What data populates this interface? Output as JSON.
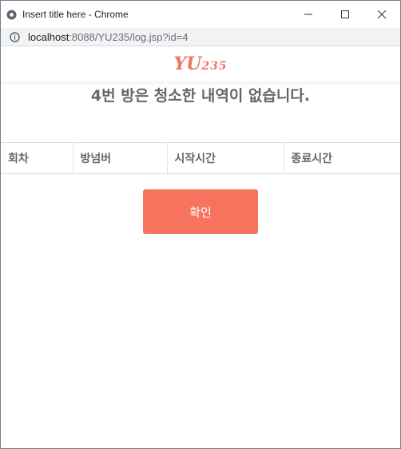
{
  "window": {
    "title": "Insert title here - Chrome",
    "url_host": "localhost",
    "url_rest": ":8088/YU235/log.jsp?id=4"
  },
  "brand": {
    "main": "YU",
    "num": "235"
  },
  "heading": "4번 방은 청소한 내역이 없습니다.",
  "table": {
    "columns": [
      "회차",
      "방넘버",
      "시작시간",
      "종료시간"
    ]
  },
  "confirm_label": "확인",
  "colors": {
    "accent": "#f7735e",
    "brand": "#f07560",
    "text": "#666666"
  }
}
